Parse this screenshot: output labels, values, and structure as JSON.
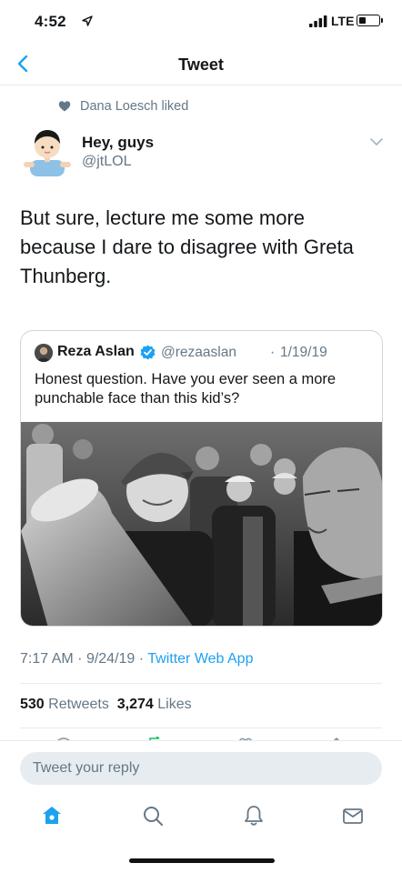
{
  "status_bar": {
    "time": "4:52",
    "network": "LTE",
    "battery_level": 0.35
  },
  "header": {
    "title": "Tweet",
    "back_icon": "chevron-left-icon"
  },
  "social_context": {
    "icon": "heart-icon",
    "text": "Dana Loesch liked"
  },
  "tweet": {
    "display_name": "Hey, guys",
    "username": "@jtLOL",
    "text": "But sure, lecture me some more because I dare to disagree with Greta Thunberg.",
    "timestamp": "7:17 AM",
    "separator": "·",
    "date": "9/24/19",
    "source": "Twitter Web App",
    "retweets_count": "530",
    "retweets_label": "Retweets",
    "likes_count": "3,274",
    "likes_label": "Likes"
  },
  "quoted_tweet": {
    "display_name": "Reza Aslan",
    "handle": "@rezaaslan",
    "separator": "·",
    "date": "1/19/19",
    "text": "Honest question. Have you ever seen a more punchable face than this kid’s?",
    "photo": "black-and-white crowd photograph",
    "verified_color": "#1da1f2"
  },
  "reply": {
    "placeholder": "Tweet your reply"
  },
  "tabs": [
    {
      "name": "home",
      "icon": "home-icon",
      "active": true
    },
    {
      "name": "search",
      "icon": "search-icon",
      "active": false
    },
    {
      "name": "notifications",
      "icon": "bell-icon",
      "active": false
    },
    {
      "name": "messages",
      "icon": "mail-icon",
      "active": false
    }
  ],
  "colors": {
    "accent": "#1da1f2",
    "secondary_text": "#657786",
    "primary_text": "#14171a",
    "divider": "#e6ecf0"
  }
}
